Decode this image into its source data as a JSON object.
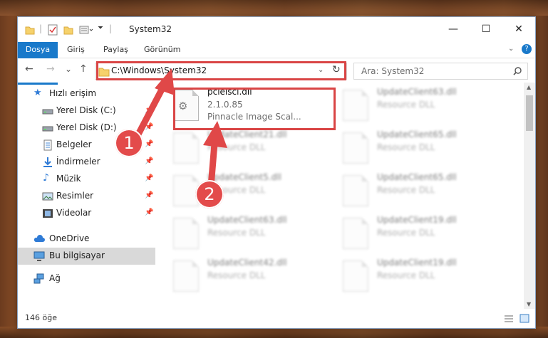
{
  "window": {
    "title": "System32",
    "minimize": "—",
    "maximize": "☐",
    "close": "✕"
  },
  "ribbon": {
    "tabs": [
      "Dosya",
      "Giriş",
      "Paylaş",
      "Görünüm"
    ]
  },
  "nav": {
    "back": "←",
    "forward": "→",
    "recent": "⌄",
    "up": "↑",
    "address": "C:\\Windows\\System32",
    "refresh": "↻",
    "search_placeholder": "Ara: System32"
  },
  "sidebar": {
    "items": [
      {
        "label": "Hızlı erişim",
        "icon": "star-icon",
        "pinned": false
      },
      {
        "label": "Yerel Disk (C:)",
        "icon": "drive-icon",
        "pinned": true
      },
      {
        "label": "Yerel Disk (D:)",
        "icon": "drive-icon",
        "pinned": true
      },
      {
        "label": "Belgeler",
        "icon": "documents-icon",
        "pinned": true
      },
      {
        "label": "İndirmeler",
        "icon": "download-icon",
        "pinned": true
      },
      {
        "label": "Müzik",
        "icon": "music-icon",
        "pinned": true
      },
      {
        "label": "Resimler",
        "icon": "pictures-icon",
        "pinned": true
      },
      {
        "label": "Videolar",
        "icon": "video-icon",
        "pinned": true
      },
      {
        "label": "OneDrive",
        "icon": "cloud-icon",
        "pinned": false
      },
      {
        "label": "Bu bilgisayar",
        "icon": "computer-icon",
        "pinned": false,
        "selected": true
      },
      {
        "label": "Ağ",
        "icon": "network-icon",
        "pinned": false
      }
    ]
  },
  "files": {
    "highlighted": {
      "name": "pcleiscl.dll",
      "version": "2.1.0.85",
      "description": "Pinnacle Image Scal..."
    },
    "left": [
      {
        "name": "UpdateClient21.dll",
        "type": "Resource DLL"
      },
      {
        "name": "UpdateClient5.dll",
        "type": "Resource DLL"
      },
      {
        "name": "UpdateClient63.dll",
        "type": "Resource DLL"
      },
      {
        "name": "UpdateClient42.dll",
        "type": "Resource DLL"
      }
    ],
    "right": [
      {
        "name": "UpdateClient63.dll",
        "type": "Resource DLL"
      },
      {
        "name": "UpdateClient65.dll",
        "type": "Resource DLL"
      },
      {
        "name": "UpdateClient65.dll",
        "type": "Resource DLL"
      },
      {
        "name": "UpdateClient19.dll",
        "type": "Resource DLL"
      },
      {
        "name": "UpdateClient19.dll",
        "type": "Resource DLL"
      }
    ]
  },
  "status": {
    "count": "146 öğe"
  },
  "annotations": {
    "step1": "1",
    "step2": "2",
    "color": "#d94545"
  }
}
